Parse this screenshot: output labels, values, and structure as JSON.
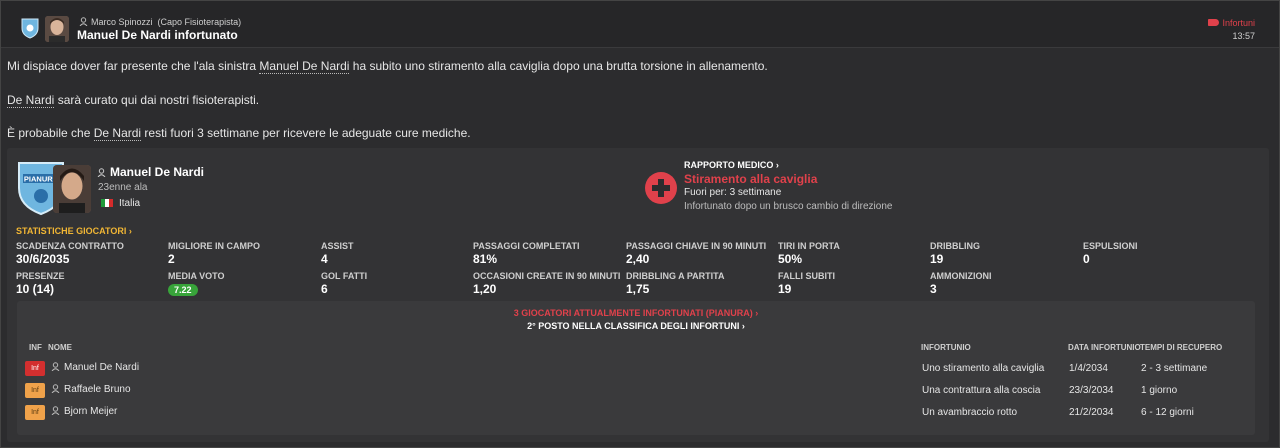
{
  "header": {
    "sender": "Marco Spinozzi",
    "sender_role": "(Capo Fisioterapista)",
    "subject": "Manuel De Nardi infortunato",
    "category": "Infortuni",
    "time": "13:57"
  },
  "message": {
    "line1_pre": "Mi dispiace dover far presente che l'ala sinistra ",
    "line1_name": "Manuel De Nardi",
    "line1_post": " ha subito uno stiramento alla caviglia dopo una brutta torsione in allenamento.",
    "line2_name": "De Nardi",
    "line2_post": " sarà curato qui dai nostri fisioterapisti.",
    "line3_pre": "È probabile che ",
    "line3_name": "De Nardi",
    "line3_post": " resti fuori 3 settimane per ricevere le adeguate cure mediche."
  },
  "player": {
    "name": "Manuel De Nardi",
    "age_line": "23enne ala",
    "nation": "Italia",
    "crest_text": "PIANURA"
  },
  "medical": {
    "title": "RAPPORTO MEDICO ›",
    "injury": "Stiramento alla caviglia",
    "out_for": "Fuori per: 3 settimane",
    "description": "Infortunato dopo un brusco cambio di direzione"
  },
  "stats": {
    "title": "STATISTICHE GIOCATORI ›",
    "items": [
      {
        "label": "SCADENZA CONTRATTO",
        "value": "30/6/2035"
      },
      {
        "label": "MIGLIORE IN CAMPO",
        "value": "2"
      },
      {
        "label": "ASSIST",
        "value": "4"
      },
      {
        "label": "PASSAGGI COMPLETATI",
        "value": "81%"
      },
      {
        "label": "PASSAGGI CHIAVE IN 90 MINUTI",
        "value": "2,40"
      },
      {
        "label": "TIRI IN PORTA",
        "value": "50%"
      },
      {
        "label": "DRIBBLING",
        "value": "19"
      },
      {
        "label": "ESPULSIONI",
        "value": "0"
      },
      {
        "label": "PRESENZE",
        "value": "10 (14)"
      },
      {
        "label": "MEDIA VOTO",
        "value": "7.22"
      },
      {
        "label": "GOL FATTI",
        "value": "6"
      },
      {
        "label": "OCCASIONI CREATE IN 90 MINUTI",
        "value": "1,20"
      },
      {
        "label": "DRIBBLING A PARTITA",
        "value": "1,75"
      },
      {
        "label": "FALLI SUBITI",
        "value": "19"
      },
      {
        "label": "AMMONIZIONI",
        "value": "3"
      }
    ]
  },
  "injury_list": {
    "title": "3 GIOCATORI ATTUALMENTE INFORTUNATI (PIANURA) ›",
    "subtitle": "2° POSTO NELLA CLASSIFICA DEGLI INFORTUNI ›",
    "columns": {
      "inf": "INF",
      "name": "NOME",
      "injury": "INFORTUNIO",
      "date": "DATA INFORTUNIO",
      "recovery": "TEMPI DI RECUPERO"
    },
    "rows": [
      {
        "badge": "Inf",
        "name": "Manuel De Nardi",
        "injury": "Uno stiramento alla caviglia",
        "date": "1/4/2034",
        "recovery": "2 - 3 settimane"
      },
      {
        "badge": "Inf",
        "name": "Raffaele Bruno",
        "injury": "Una contrattura alla coscia",
        "date": "23/3/2034",
        "recovery": "1 giorno"
      },
      {
        "badge": "Inf",
        "name": "Bjorn Meijer",
        "injury": "Un avambraccio rotto",
        "date": "21/2/2034",
        "recovery": "6 - 12 giorni"
      }
    ]
  },
  "colors": {
    "accent_red": "#e0414b",
    "stats_gold": "#f1b634",
    "rating_green": "#38a43a"
  }
}
